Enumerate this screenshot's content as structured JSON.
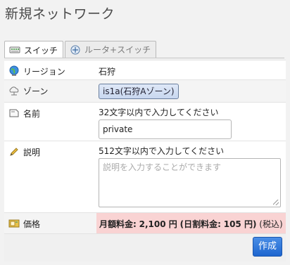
{
  "page": {
    "title": "新規ネットワーク"
  },
  "tabs": [
    {
      "label": "スイッチ",
      "icon": "switch-icon",
      "active": true
    },
    {
      "label": "ルータ+スイッチ",
      "icon": "router-icon",
      "active": false
    }
  ],
  "form": {
    "region": {
      "label": "リージョン",
      "icon": "globe-icon",
      "value": "石狩"
    },
    "zone": {
      "label": "ゾーン",
      "icon": "cloud-icon",
      "value": "is1a(石狩Aゾーン)"
    },
    "name": {
      "label": "名前",
      "icon": "tag-icon",
      "hint": "32文字以内で入力してください",
      "value": "private"
    },
    "description": {
      "label": "説明",
      "icon": "pencil-icon",
      "hint": "512文字以内で入力してください",
      "placeholder": "説明を入力することができます"
    },
    "price": {
      "label": "価格",
      "icon": "price-icon",
      "monthly_label": "月額料金:",
      "monthly_value": "2,100 円",
      "daily_open": "(日割料金:",
      "daily_value": "105 円)",
      "tax_note": "(税込)"
    }
  },
  "footer": {
    "create_label": "作成"
  },
  "colors": {
    "accent": "#2a72d9",
    "price_bg": "#f9d3d3",
    "zone_button": "#d3dff3"
  }
}
